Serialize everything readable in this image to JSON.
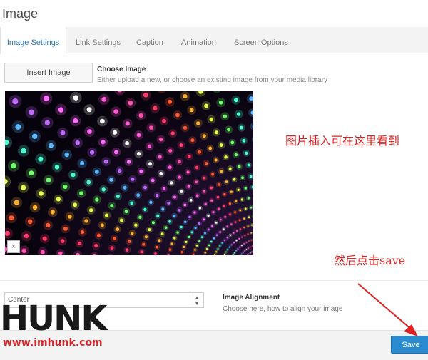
{
  "page": {
    "title": "Image"
  },
  "tabs": [
    {
      "label": "Image Settings",
      "active": true
    },
    {
      "label": "Link Settings",
      "active": false
    },
    {
      "label": "Caption",
      "active": false
    },
    {
      "label": "Animation",
      "active": false
    },
    {
      "label": "Screen Options",
      "active": false
    }
  ],
  "image_section": {
    "button_label": "Insert Image",
    "title": "Choose Image",
    "description": "Either upload a new, or choose an existing image from your media library",
    "remove_icon": "×"
  },
  "annotations": {
    "note_image": "图片插入可在这里看到",
    "note_save": "然后点击save",
    "color": "#e02222"
  },
  "alignment": {
    "selected": "Center",
    "title": "Image Alignment",
    "description": "Choose here, how to align your image"
  },
  "footer": {
    "save_label": "Save"
  },
  "watermark": {
    "logo_text": "HUNK",
    "url": "www.imhunk.com"
  },
  "colors": {
    "accent": "#2b8bd1",
    "tab_active": "#2e7ab8",
    "watermark_url": "#d9252a"
  }
}
